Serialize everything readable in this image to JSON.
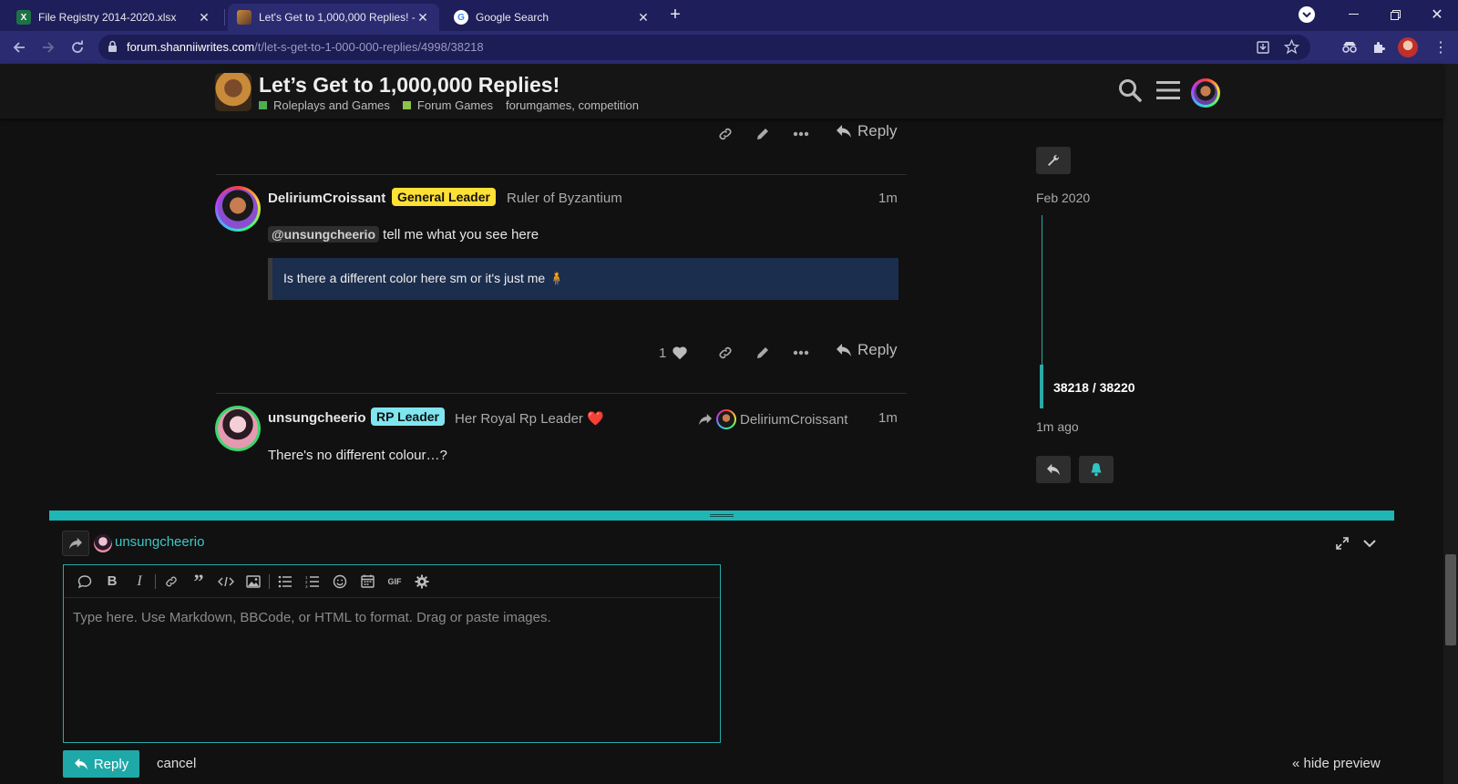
{
  "browser": {
    "tabs": [
      {
        "title": "File Registry 2014-2020.xlsx",
        "active": false,
        "favicon": "excel-icon"
      },
      {
        "title": "Let's Get to 1,000,000 Replies! - F",
        "active": true,
        "favicon": "forum-icon"
      },
      {
        "title": "Google Search",
        "active": false,
        "favicon": "google-icon"
      }
    ],
    "url_host": "forum.shanniiwrites.com",
    "url_path": "/t/let-s-get-to-1-000-000-replies/4998/38218"
  },
  "header": {
    "title": "Let’s Get to 1,000,000 Replies!",
    "categories": [
      {
        "label": "Roleplays and Games",
        "color": "#4caf50"
      },
      {
        "label": "Forum Games",
        "color": "#8bc34a"
      }
    ],
    "tags": "forumgames, competition"
  },
  "posts": [
    {
      "username": "DeliriumCroissant",
      "badge": "General Leader",
      "badge_color": "#ffe034",
      "user_title": "Ruler of Byzantium",
      "time": "1m",
      "mention": "@unsungcheerio",
      "text": "tell me what you see here",
      "quote": "Is there a different color here sm or it's just me 🧍",
      "likes": "1",
      "reply_label": "Reply"
    },
    {
      "username": "unsungcheerio",
      "badge": "RP Leader",
      "badge_color": "#7fe6f0",
      "user_title": "Her Royal Rp Leader ❤️",
      "reply_to": "DeliriumCroissant",
      "time": "1m",
      "text": "There's no different colour…?"
    }
  ],
  "prev_post": {
    "reply_label": "Reply"
  },
  "timeline": {
    "date": "Feb 2020",
    "position": "38218 / 38220",
    "ago": "1m ago"
  },
  "composer": {
    "reply_to_user": "unsungcheerio",
    "placeholder": "Type here. Use Markdown, BBCode, or HTML to format. Drag or paste images.",
    "submit_label": "Reply",
    "cancel_label": "cancel",
    "hide_preview_label": "« hide preview"
  }
}
